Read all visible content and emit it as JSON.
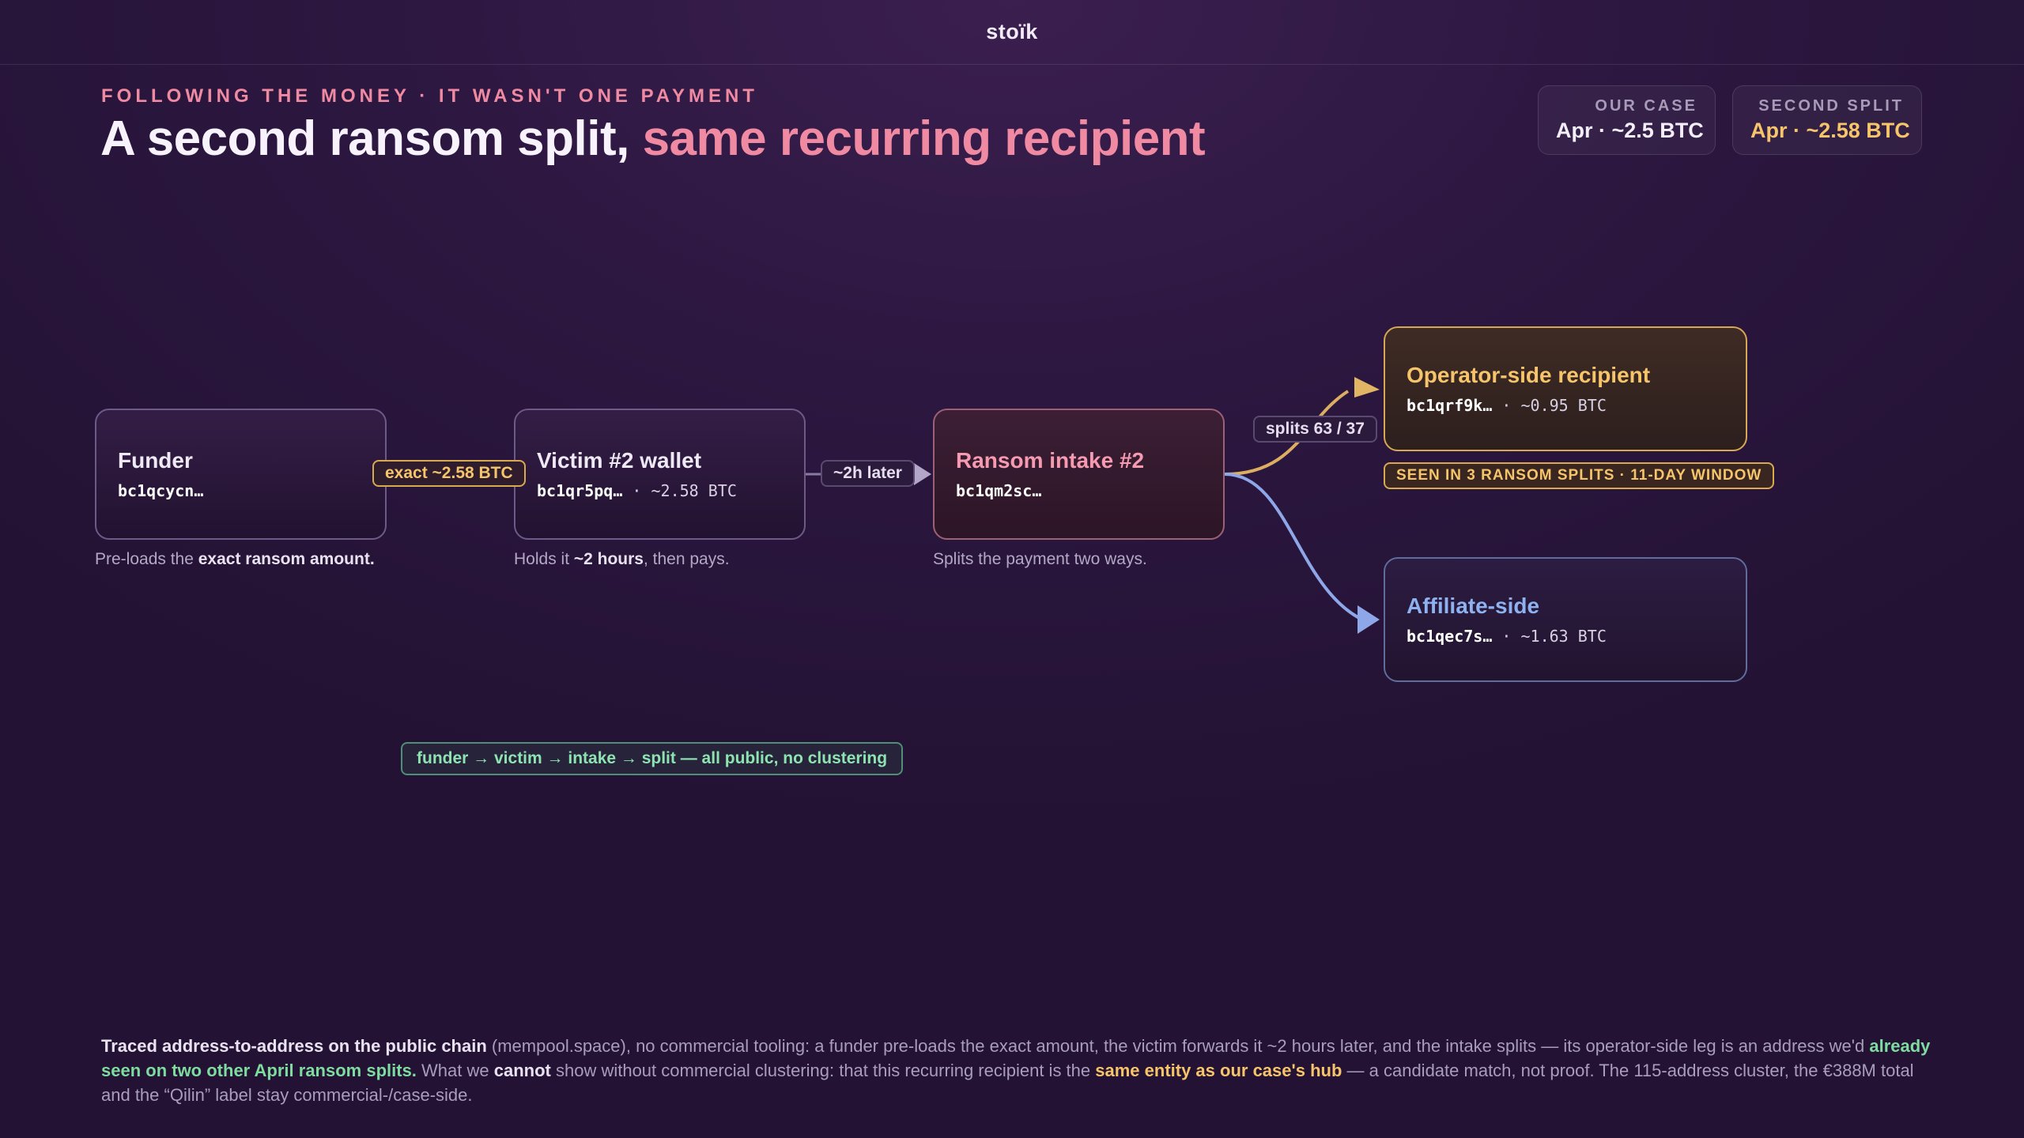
{
  "brand": "stoïk",
  "kicker": "FOLLOWING THE MONEY · IT WASN'T ONE PAYMENT",
  "headline": {
    "main": "A second ransom split, ",
    "accent": "same recurring recipient"
  },
  "stats": [
    {
      "label": "OUR CASE",
      "value": "Apr · ~2.5 BTC"
    },
    {
      "label": "SECOND SPLIT",
      "value": "Apr · ~2.58 BTC"
    }
  ],
  "nodes": {
    "funder": {
      "title": "Funder",
      "address": "bc1qcycn…",
      "amount": ""
    },
    "victim": {
      "title": "Victim #2 wallet",
      "address": "bc1qr5pq…",
      "amount": "~2.58 BTC"
    },
    "intake": {
      "title": "Ransom intake #2",
      "address": "bc1qm2sc…",
      "amount": ""
    },
    "operator": {
      "title": "Operator-side recipient",
      "address": "bc1qrf9k…",
      "amount": "~0.95 BTC"
    },
    "affiliate": {
      "title": "Affiliate-side",
      "address": "bc1qec7s…",
      "amount": "~1.63 BTC"
    }
  },
  "separator": " · ",
  "edge_labels": {
    "funder_to_victim": "exact ~2.58 BTC",
    "victim_to_intake": "~2h later",
    "split": "splits 63 / 37"
  },
  "badges": {
    "seen": "SEEN IN 3 RANSOM SPLITS · 11-DAY WINDOW",
    "chain": "funder → victim → intake → split — all public, no clustering"
  },
  "captions": {
    "funder": {
      "pre": "Pre-loads the ",
      "bold": "exact ransom amount.",
      "post": ""
    },
    "victim": {
      "pre": "Holds it ",
      "bold": "~2 hours",
      "post": ", then pays."
    },
    "intake": {
      "text": "Splits the payment two ways."
    }
  },
  "footer": {
    "s1": "Traced address-to-address on the public chain",
    "s2": " (mempool.space), no commercial tooling: a funder pre-loads the exact amount, the victim forwards it ~2 hours later, and the intake splits — its operator-side leg is an address we'd ",
    "s3": "already seen on two other April ransom splits.",
    "s4": " What we ",
    "s5": "cannot",
    "s6": " show without commercial clustering: that this recurring recipient is the ",
    "s7": "same entity as our case's hub",
    "s8": " — a candidate match, not proof. The 115-address cluster, the €388M total and the “Qilin” label stay commercial-/case-side."
  },
  "colors": {
    "background": "#2c1740",
    "accent_pink": "#f08aa2",
    "accent_gold": "#f6c46a",
    "accent_blue": "#8eb1f0",
    "accent_green": "#7edc9f"
  }
}
